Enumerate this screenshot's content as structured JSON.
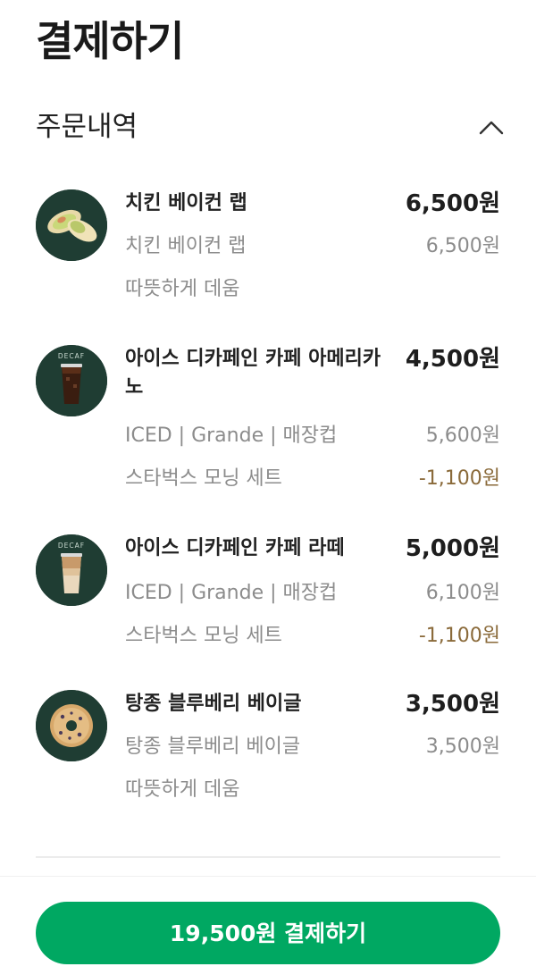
{
  "header": {
    "title": "결제하기"
  },
  "order_section": {
    "title": "주문내역",
    "toggle_icon": "chevron-up-icon"
  },
  "items": [
    {
      "name": "치킨 베이컨 랩",
      "price": "6,500원",
      "details": [
        {
          "label": "치킨 베이컨 랩",
          "price": "6,500원"
        },
        {
          "label": "따뜻하게 데움",
          "price": ""
        }
      ],
      "thumbnail": "chicken-bacon-wrap-image"
    },
    {
      "name": "아이스 디카페인 카페 아메리카노",
      "price": "4,500원",
      "details": [
        {
          "label": "ICED | Grande | 매장컵",
          "price": "5,600원"
        },
        {
          "label": "스타벅스 모닝 세트",
          "price": "-1,100원"
        }
      ],
      "thumbnail": "iced-decaf-americano-image",
      "badge": "DECAF"
    },
    {
      "name": "아이스 디카페인 카페 라떼",
      "price": "5,000원",
      "details": [
        {
          "label": "ICED | Grande | 매장컵",
          "price": "6,100원"
        },
        {
          "label": "스타벅스 모닝 세트",
          "price": "-1,100원"
        }
      ],
      "thumbnail": "iced-decaf-latte-image",
      "badge": "DECAF"
    },
    {
      "name": "탕종 블루베리 베이글",
      "price": "3,500원",
      "details": [
        {
          "label": "탕종 블루베리 베이글",
          "price": "3,500원"
        },
        {
          "label": "따뜻하게 데움",
          "price": ""
        }
      ],
      "thumbnail": "blueberry-bagel-image"
    }
  ],
  "footer": {
    "pay_label": "19,500원 결제하기"
  },
  "colors": {
    "accent": "#00a862",
    "thumb_bg": "#1f3d33",
    "discount": "#8a6a3a",
    "muted_text": "#8c8c8c"
  }
}
